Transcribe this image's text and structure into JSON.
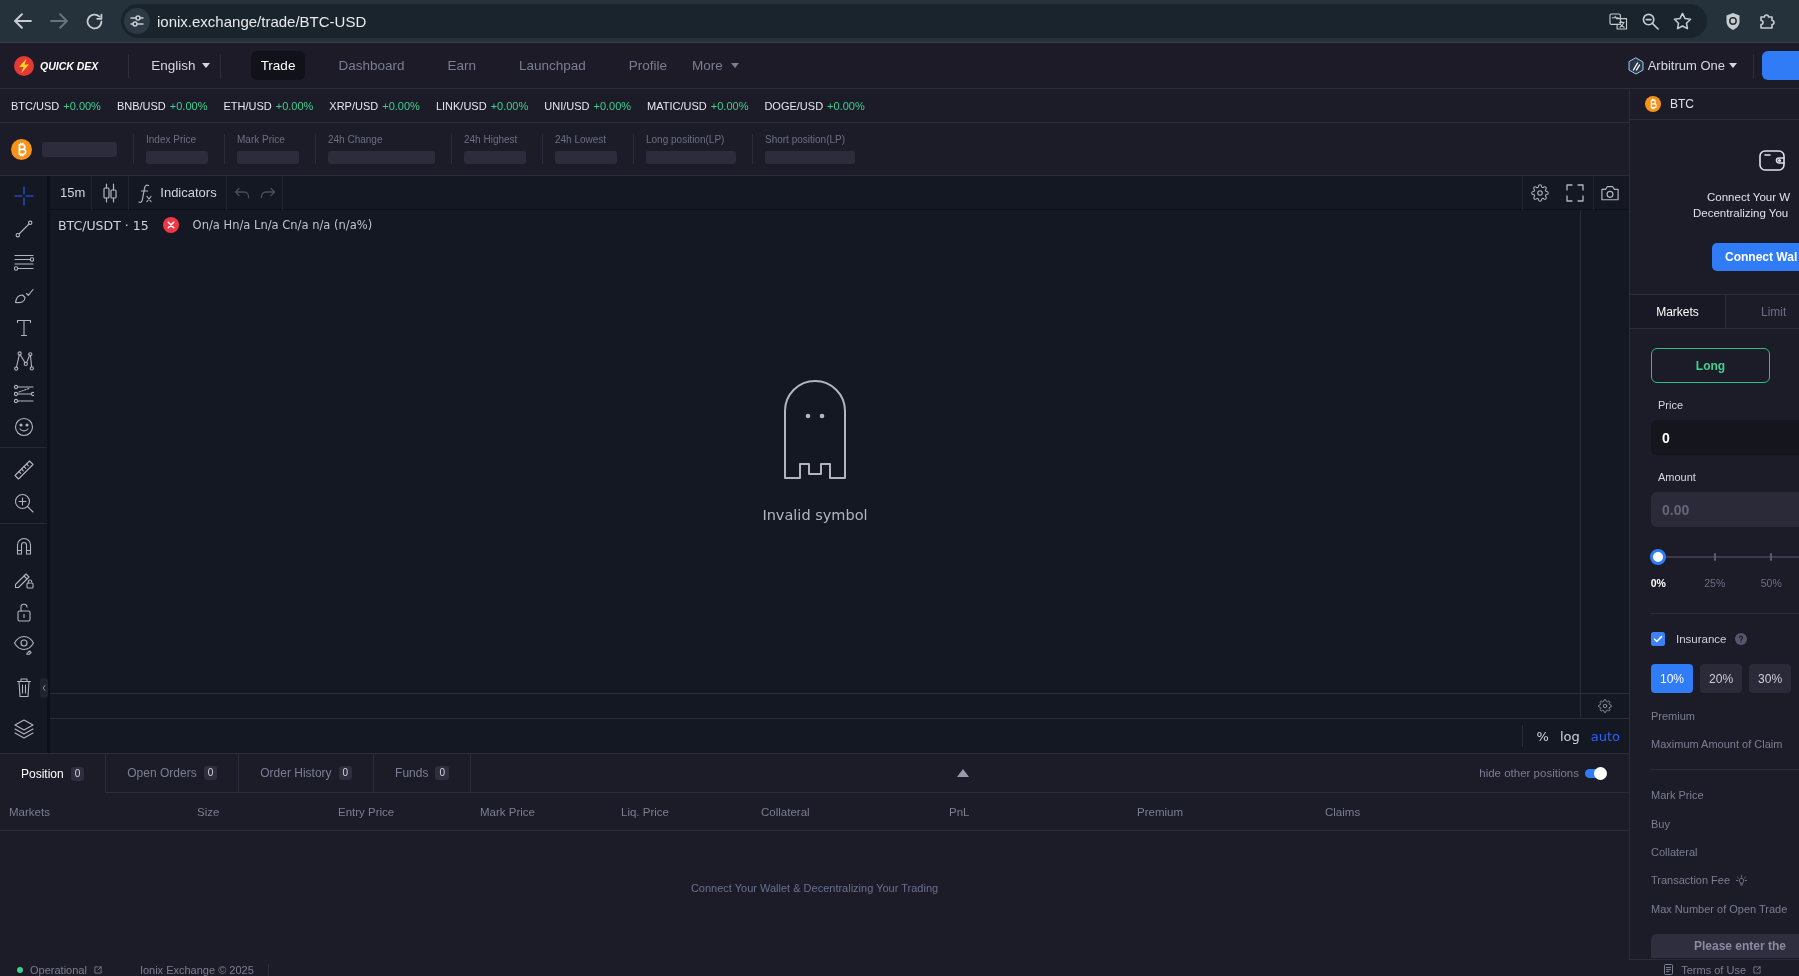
{
  "browser": {
    "url": "ionix.exchange/trade/BTC-USD",
    "forward": {
      "disabled": true
    }
  },
  "nav": {
    "logo": "QUICK DEX",
    "language": "English",
    "items": [
      {
        "label": "Trade",
        "selected": true
      },
      {
        "label": "Dashboard",
        "selected": false
      },
      {
        "label": "Earn",
        "selected": false
      },
      {
        "label": "Launchpad",
        "selected": false
      },
      {
        "label": "Profile",
        "selected": false
      }
    ],
    "more": "More",
    "network": "Arbitrum One"
  },
  "ticker": [
    {
      "pair": "BTC/USD",
      "change": "+0.00%",
      "positive": true
    },
    {
      "pair": "BNB/USD",
      "change": "+0.00%",
      "positive": true
    },
    {
      "pair": "ETH/USD",
      "change": "+0.00%",
      "positive": true
    },
    {
      "pair": "XRP/USD",
      "change": "+0.00%",
      "positive": true
    },
    {
      "pair": "LINK/USD",
      "change": "+0.00%",
      "positive": true
    },
    {
      "pair": "UNI/USD",
      "change": "+0.00%",
      "positive": true
    },
    {
      "pair": "MATIC/USD",
      "change": "+0.00%",
      "positive": true
    },
    {
      "pair": "DOGE/USD",
      "change": "+0.00%",
      "positive": true
    }
  ],
  "market_info": {
    "symbol": {
      "loading": true
    },
    "fields": [
      {
        "label": "Index Price",
        "loading": true
      },
      {
        "label": "Mark Price",
        "loading": true
      },
      {
        "label": "24h Change",
        "loading": true
      },
      {
        "label": "24h Highest",
        "loading": true
      },
      {
        "label": "24h Lowest",
        "loading": true
      },
      {
        "label": "Long position(LP)",
        "loading": true
      },
      {
        "label": "Short position(LP)",
        "loading": true
      }
    ]
  },
  "chart": {
    "toolbar": {
      "interval": "15m",
      "indicators": "Indicators",
      "history": [
        {
          "kind": "undo",
          "disabled": true
        },
        {
          "kind": "redo",
          "disabled": true
        }
      ]
    },
    "drawing_tools": [
      [
        {
          "kind": "crosshair",
          "selected": true
        },
        {
          "kind": "trend_line",
          "selected": false
        },
        {
          "kind": "fib",
          "selected": false
        },
        {
          "kind": "brush",
          "selected": false
        },
        {
          "kind": "text",
          "selected": false
        },
        {
          "kind": "pattern",
          "selected": false
        },
        {
          "kind": "prediction",
          "selected": false
        },
        {
          "kind": "emoji",
          "selected": false
        }
      ],
      [
        {
          "kind": "ruler",
          "selected": false
        },
        {
          "kind": "zoom_in",
          "selected": false
        }
      ],
      [
        {
          "kind": "magnet",
          "selected": false
        },
        {
          "kind": "pencil_lock",
          "selected": false
        },
        {
          "kind": "lock",
          "selected": false
        },
        {
          "kind": "eye",
          "selected": false
        }
      ],
      [
        {
          "kind": "trash",
          "selected": false
        }
      ],
      [
        {
          "kind": "layers",
          "selected": false
        }
      ]
    ],
    "legend": {
      "title": "BTC/USDT · 15",
      "error": true,
      "values": "On/a Hn/a Ln/a Cn/a n/a (n/a%)"
    },
    "message": "Invalid symbol",
    "scale_modes": [
      {
        "label": "%",
        "selected": false
      },
      {
        "label": "log",
        "selected": false
      },
      {
        "label": "auto",
        "selected": true
      }
    ]
  },
  "positions": {
    "tabs": [
      {
        "label": "Position",
        "count": "0",
        "selected": true
      },
      {
        "label": "Open Orders",
        "count": "0",
        "selected": false
      },
      {
        "label": "Order History",
        "count": "0",
        "selected": false
      },
      {
        "label": "Funds",
        "count": "0",
        "selected": false
      }
    ],
    "hide_other_positions": {
      "label": "hide other positions",
      "on": true
    },
    "columns": [
      "Markets",
      "Size",
      "Entry Price",
      "Mark Price",
      "Liq. Price",
      "Collateral",
      "PnL",
      "Premium",
      "Claims"
    ],
    "empty_message": "Connect Your Wallet & Decentralizing Your Trading"
  },
  "order_panel": {
    "asset": "BTC",
    "wallet_prompt": [
      "Connect Your W",
      "Decentralizing You"
    ],
    "connect_button": "Connect Wal",
    "tabs": [
      {
        "label": "Markets",
        "selected": true
      },
      {
        "label": "Limit",
        "selected": false
      }
    ],
    "sides": [
      {
        "label": "Long",
        "selected": true
      }
    ],
    "price": {
      "label": "Price",
      "value": "0"
    },
    "amount": {
      "label": "Amount",
      "placeholder": "0.00"
    },
    "slider": {
      "level": 0,
      "marks": [
        {
          "label": "0%",
          "selected": true
        },
        {
          "label": "25%",
          "selected": false
        },
        {
          "label": "50%",
          "selected": false
        }
      ]
    },
    "insurance": {
      "label": "Insurance",
      "checked": true,
      "options": [
        {
          "label": "10%",
          "selected": true
        },
        {
          "label": "20%",
          "selected": false
        },
        {
          "label": "30%",
          "selected": false
        }
      ]
    },
    "insurance_details": [
      "Premium",
      "Maximum Amount of Claim"
    ],
    "summary": [
      {
        "label": "Mark Price",
        "kind": "plain"
      },
      {
        "label": "Buy",
        "kind": "plain"
      },
      {
        "label": "Collateral",
        "kind": "plain"
      },
      {
        "label": "Transaction Fee",
        "kind": "tip"
      },
      {
        "label": "Max Number of Open Trade",
        "kind": "plain"
      }
    ],
    "submit": {
      "label": "Please enter the",
      "disabled": true
    }
  },
  "footer": {
    "status": {
      "label": "Operational",
      "operational": true
    },
    "copyright": "Ionix Exchange © 2025",
    "terms": "Terms of Use"
  }
}
